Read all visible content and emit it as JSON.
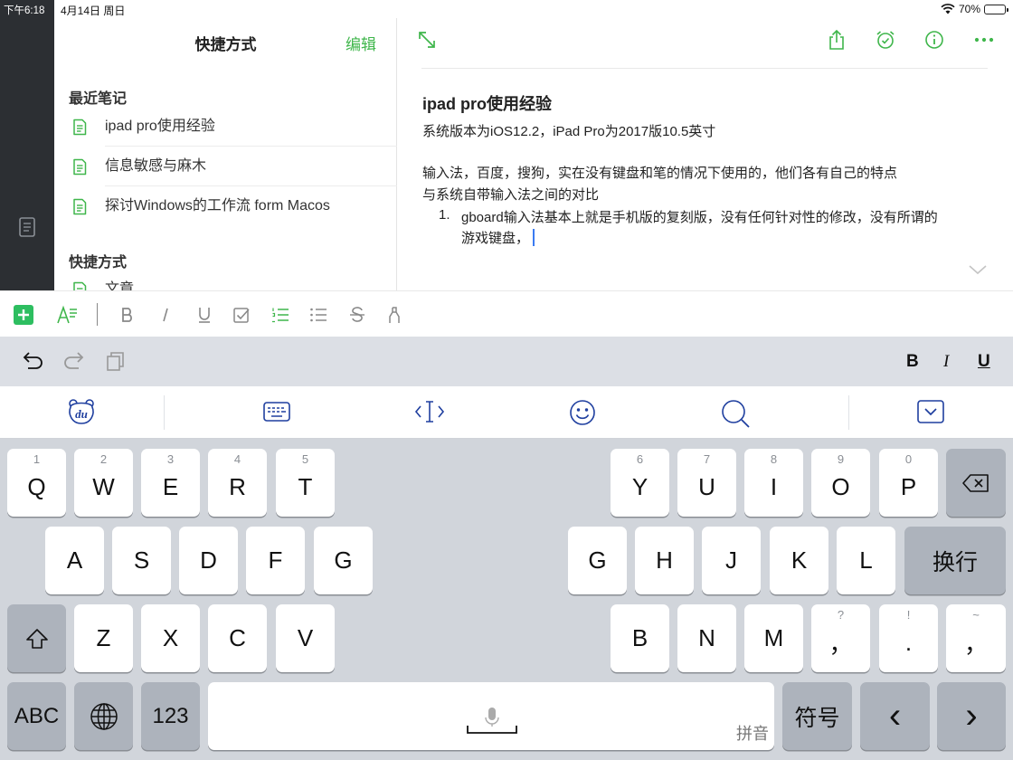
{
  "status_bar": {
    "time": "下午6:18",
    "date": "4月14日 周日",
    "battery": "70%",
    "battery_level": 0.7
  },
  "sidebar": {
    "title": "快捷方式",
    "edit_label": "编辑",
    "recent_heading": "最近笔记",
    "recent_notes": [
      {
        "label": "ipad pro使用经验"
      },
      {
        "label": "信息敏感与麻木"
      },
      {
        "label": "探讨Windows的工作流 form Macos"
      }
    ],
    "shortcuts_heading": "快捷方式",
    "shortcut_items": [
      {
        "label": "文章"
      }
    ]
  },
  "editor": {
    "toolbar": [
      "expand-icon",
      "share-icon",
      "reminder-icon",
      "info-icon",
      "more-icon"
    ],
    "title": "ipad pro使用经验",
    "line1": "系统版本为iOS12.2，iPad Pro为2017版10.5英寸",
    "line2": "输入法，百度，搜狗，实在没有键盘和笔的情况下使用的，他们各有自己的特点",
    "line3": "与系统自带输入法之间的对比",
    "list_number": "1.",
    "list_item_line1": "gboard输入法基本上就是手机版的复刻版，没有任何针对性的修改，没有所谓的",
    "list_item_line2": "游戏键盘，"
  },
  "format_toolbar": [
    "add",
    "text-style",
    "bold",
    "italic",
    "underline",
    "checkbox",
    "numbered-list",
    "bulleted-list",
    "strikethrough",
    "highlighter"
  ],
  "shortcut_bar": {
    "bold": "B",
    "italic": "I",
    "underline": "U"
  },
  "ime_bar": [
    "baidu-logo-icon",
    "keyboard-icon",
    "cursor-move-icon",
    "emoji-icon",
    "search-icon",
    "hide-keyboard-icon"
  ],
  "baidu_logo_text": "du",
  "keyboard": {
    "row1_left": [
      {
        "main": "Q",
        "hint": "1"
      },
      {
        "main": "W",
        "hint": "2"
      },
      {
        "main": "E",
        "hint": "3"
      },
      {
        "main": "R",
        "hint": "4"
      },
      {
        "main": "T",
        "hint": "5"
      }
    ],
    "row1_right": [
      {
        "main": "Y",
        "hint": "6"
      },
      {
        "main": "U",
        "hint": "7"
      },
      {
        "main": "I",
        "hint": "8"
      },
      {
        "main": "O",
        "hint": "9"
      },
      {
        "main": "P",
        "hint": "0"
      }
    ],
    "row2_left": [
      "A",
      "S",
      "D",
      "F",
      "G"
    ],
    "row2_right": [
      "G",
      "H",
      "J",
      "K",
      "L"
    ],
    "return_label": "换行",
    "row3_left": [
      "Z",
      "X",
      "C",
      "V"
    ],
    "row3_right": [
      {
        "main": "B",
        "hint": ""
      },
      {
        "main": "N",
        "hint": ""
      },
      {
        "main": "M",
        "hint": ""
      },
      {
        "main": "，",
        "hint": "?"
      },
      {
        "main": ".",
        "hint": "!"
      },
      {
        "main": "，",
        "hint": "~"
      }
    ],
    "abc_label": "ABC",
    "num_label": "123",
    "space_sub_label": "拼音",
    "symbols_label": "符号",
    "left_arrow": "‹",
    "right_arrow": "›"
  },
  "colors": {
    "accent": "#3fb64b",
    "rail": "#2c2f33",
    "caret": "#3a7bf2"
  }
}
